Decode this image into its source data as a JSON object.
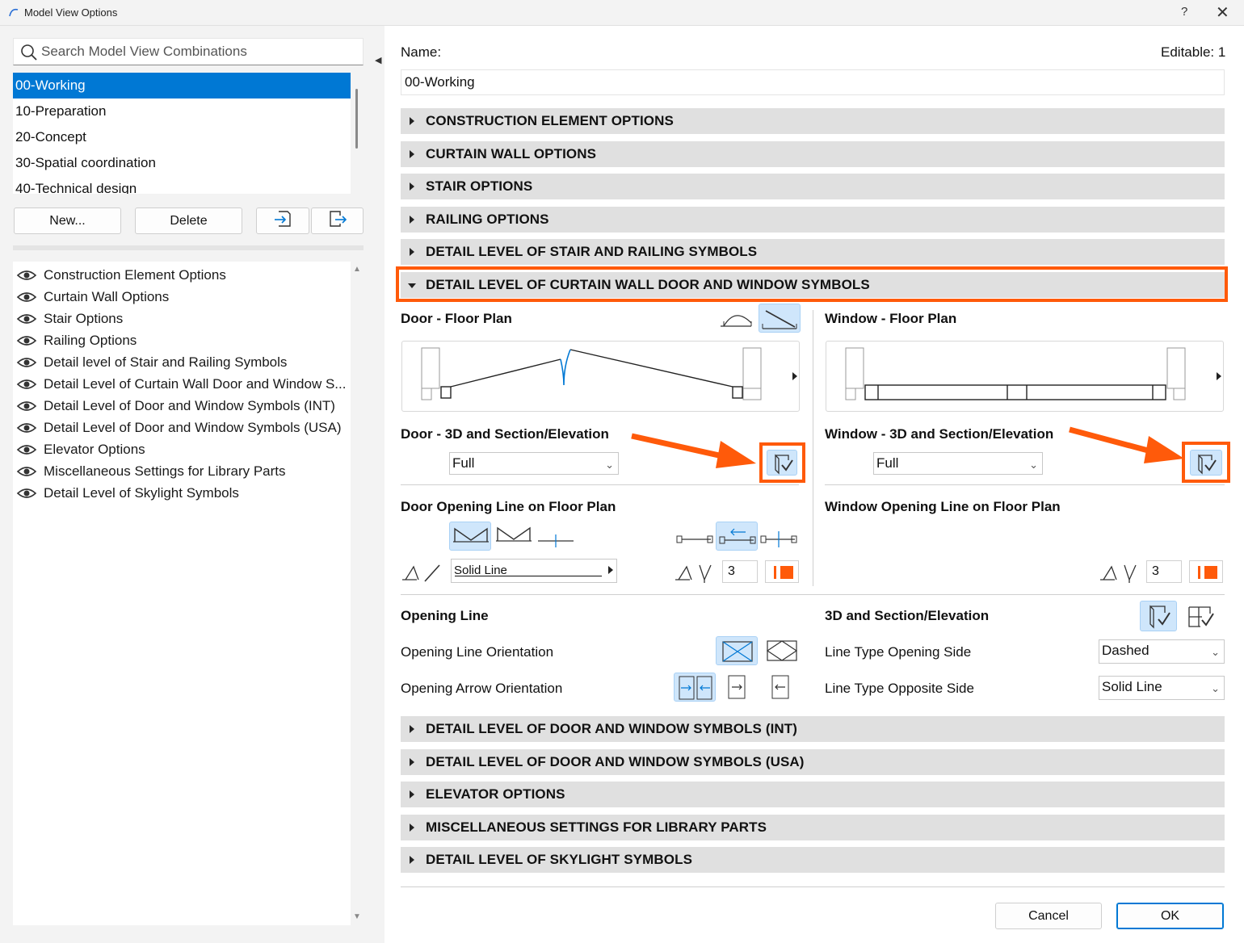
{
  "window": {
    "title": "Model View Options",
    "help": "?",
    "close": "✕"
  },
  "search": {
    "placeholder": "Search Model View Combinations"
  },
  "combinations": [
    "00-Working",
    "10-Preparation",
    "20-Concept",
    "30-Spatial coordination",
    "40-Technical design"
  ],
  "left_buttons": {
    "new": "New...",
    "delete": "Delete"
  },
  "tree_items": [
    "Construction Element Options",
    "Curtain Wall Options",
    "Stair Options",
    "Railing Options",
    "Detail level of Stair and Railing Symbols",
    "Detail Level of Curtain Wall Door and Window S...",
    "Detail Level of Door and Window Symbols (INT)",
    "Detail Level of Door and Window Symbols (USA)",
    "Elevator Options",
    "Miscellaneous Settings for Library Parts",
    "Detail Level of Skylight Symbols"
  ],
  "name_label": "Name:",
  "editable": "Editable: 1",
  "name_value": "00-Working",
  "sections_top": [
    "CONSTRUCTION ELEMENT OPTIONS",
    "CURTAIN WALL OPTIONS",
    "STAIR OPTIONS",
    "RAILING OPTIONS",
    "DETAIL LEVEL OF STAIR AND RAILING SYMBOLS"
  ],
  "open_section": "DETAIL LEVEL OF CURTAIN WALL DOOR AND WINDOW SYMBOLS",
  "door": {
    "floor_plan": "Door - Floor Plan",
    "section_3d": "Door - 3D and Section/Elevation",
    "section_3d_value": "Full",
    "opening_line": "Door Opening Line on Floor Plan",
    "line_type": "Solid Line",
    "pen_value": "3"
  },
  "window_group": {
    "floor_plan": "Window - Floor Plan",
    "section_3d": "Window - 3D and Section/Elevation",
    "section_3d_value": "Full",
    "opening_line": "Window Opening Line on Floor Plan",
    "pen_value": "3"
  },
  "opening": {
    "heading": "Opening Line",
    "orientation": "Opening Line Orientation",
    "arrow": "Opening Arrow Orientation"
  },
  "section3d": {
    "heading": "3D and Section/Elevation",
    "line_opening_label": "Line Type Opening Side",
    "line_opening_value": "Dashed",
    "line_opposite_label": "Line Type Opposite Side",
    "line_opposite_value": "Solid Line"
  },
  "sections_bottom": [
    "DETAIL LEVEL OF DOOR AND WINDOW SYMBOLS (INT)",
    "DETAIL LEVEL OF DOOR AND WINDOW SYMBOLS (USA)",
    "ELEVATOR OPTIONS",
    "MISCELLANEOUS SETTINGS FOR LIBRARY PARTS",
    "DETAIL LEVEL OF SKYLIGHT SYMBOLS"
  ],
  "footer": {
    "cancel": "Cancel",
    "ok": "OK"
  },
  "colors": {
    "accent": "#0078d4",
    "highlight": "#ff5a0a",
    "icon_active": "#cfe6fb"
  }
}
